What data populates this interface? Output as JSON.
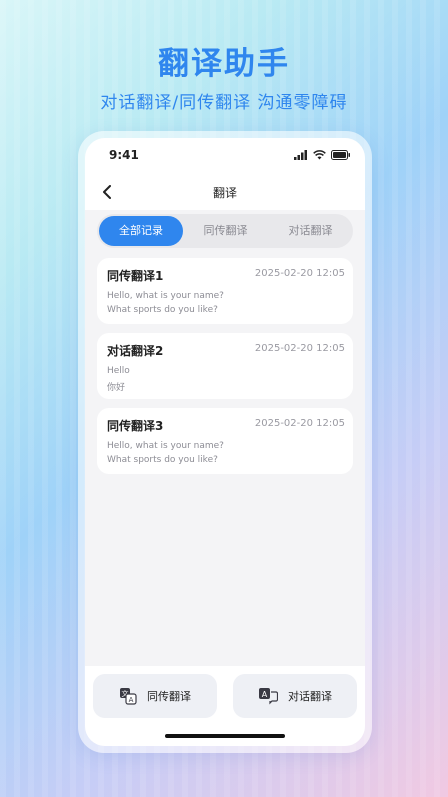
{
  "hero": {
    "title": "翻译助手",
    "subtitle": "对话翻译/同传翻译 沟通零障碍"
  },
  "status_bar": {
    "time": "9:41",
    "icons": [
      "signal-icon",
      "wifi-icon",
      "battery-icon"
    ]
  },
  "nav": {
    "back_icon": "chevron-left-icon",
    "title": "翻译"
  },
  "tabs": [
    {
      "label": "全部记录",
      "active": true
    },
    {
      "label": "同传翻译",
      "active": false
    },
    {
      "label": "对话翻译",
      "active": false
    }
  ],
  "records": [
    {
      "title": "同传翻译1",
      "time": "2025-02-20 12:05",
      "line1": "Hello, what is your name?",
      "line2": "What sports do you like?"
    },
    {
      "title": "对话翻译2",
      "time": "2025-02-20 12:05",
      "line1": "Hello",
      "line2": "你好"
    },
    {
      "title": "同传翻译3",
      "time": "2025-02-20 12:05",
      "line1": "Hello, what is your name?",
      "line2": "What sports do you like?"
    }
  ],
  "bottom": {
    "simultaneous": {
      "label": "同传翻译",
      "icon": "translate-icon"
    },
    "dialogue": {
      "label": "对话翻译",
      "icon": "dialogue-translate-icon"
    }
  },
  "colors": {
    "accent": "#2f86ee",
    "card_bg": "#ffffff",
    "screen_bg": "#f4f4f6"
  }
}
